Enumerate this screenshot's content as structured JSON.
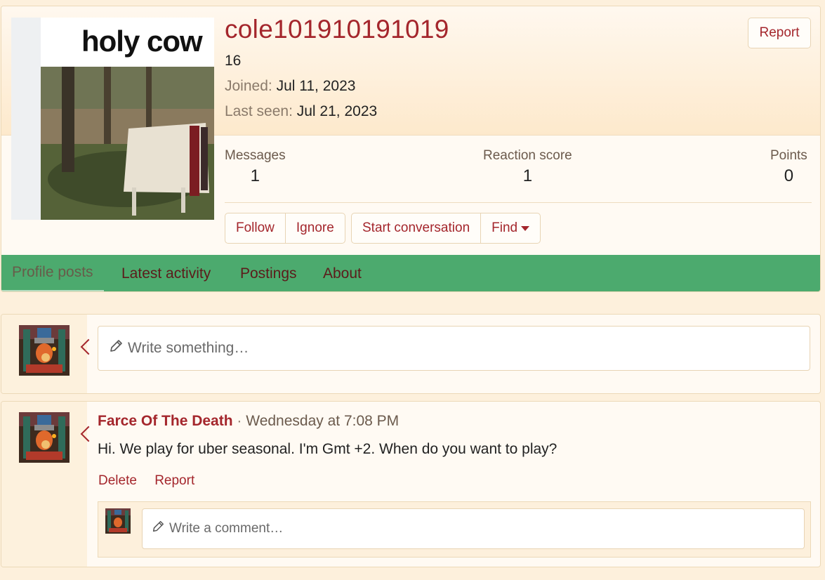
{
  "profile": {
    "username": "cole101910191019",
    "user_title": "16",
    "joined_label": "Joined:",
    "joined_value": "Jul 11, 2023",
    "last_seen_label": "Last seen:",
    "last_seen_value": "Jul 21, 2023",
    "report_label": "Report",
    "avatar_caption": "holy cow",
    "stats": [
      {
        "label": "Messages",
        "value": "1"
      },
      {
        "label": "Reaction score",
        "value": "1"
      },
      {
        "label": "Points",
        "value": "0"
      }
    ],
    "buttons": {
      "follow": "Follow",
      "ignore": "Ignore",
      "start_conversation": "Start conversation",
      "find": "Find"
    }
  },
  "tabs": [
    {
      "label": "Profile posts",
      "active": true
    },
    {
      "label": "Latest activity",
      "active": false
    },
    {
      "label": "Postings",
      "active": false
    },
    {
      "label": "About",
      "active": false
    }
  ],
  "composer": {
    "placeholder": "Write something…"
  },
  "post": {
    "author": "Farce Of The Death",
    "separator": "·",
    "time": "Wednesday at 7:08 PM",
    "text": "Hi. We play for uber seasonal. I'm Gmt +2. When do you want to play?",
    "actions": {
      "delete": "Delete",
      "report": "Report"
    },
    "comment_placeholder": "Write a comment…"
  },
  "colors": {
    "accent": "#a4262c",
    "tab_bar": "#4caa6e",
    "page_bg": "#fdf0dc"
  }
}
